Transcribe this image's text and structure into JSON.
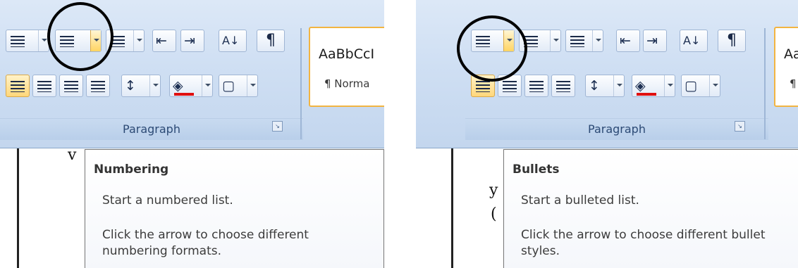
{
  "left": {
    "group_label": "Paragraph",
    "styles_sample": "AaBbCcI",
    "styles_name": "¶ Norma",
    "tooltip": {
      "title": "Numbering",
      "description": "Start a numbered list.",
      "detail": "Click the arrow to choose different numbering formats."
    }
  },
  "right": {
    "group_label": "Paragraph",
    "styles_sample": "Aa",
    "styles_name": "¶",
    "tooltip": {
      "title": "Bullets",
      "description": "Start a bulleted list.",
      "detail": "Click the arrow to choose different bullet styles."
    }
  },
  "glyphs": {
    "sort": "A↓",
    "pilcrow": "¶",
    "shading": "◈",
    "border": "▢",
    "decrease_indent": "⇤",
    "increase_indent": "⇥",
    "line_spacing": "↕"
  },
  "colors": {
    "ribbon": "#cfdff3",
    "highlight": "#ffd77a",
    "styles_border": "#f2b441",
    "shading_red": "#e01010",
    "group_label": "#2c4a75"
  }
}
